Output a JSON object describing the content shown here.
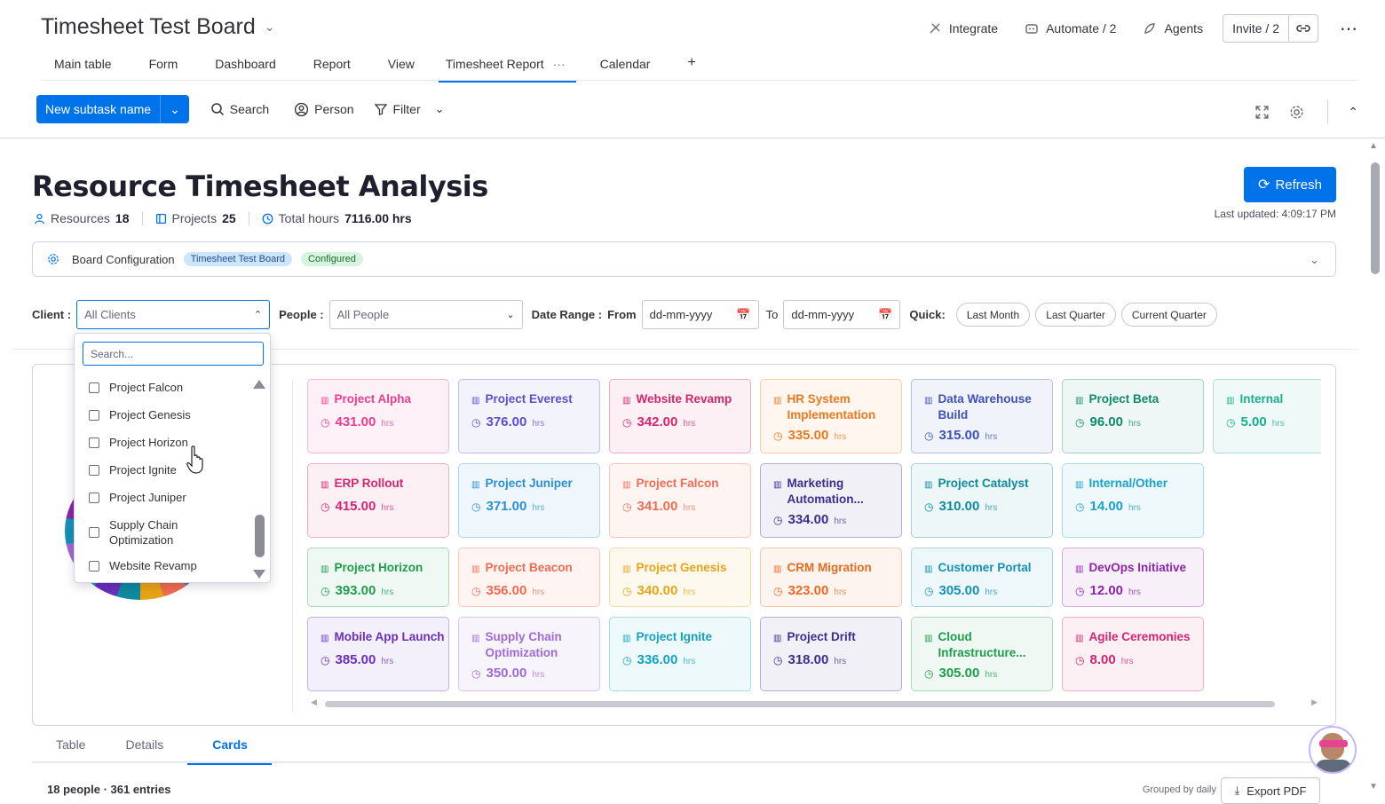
{
  "header": {
    "board_title": "Timesheet Test Board",
    "integrate": "Integrate",
    "automate": "Automate / 2",
    "agents": "Agents",
    "invite": "Invite / 2"
  },
  "tabs": [
    {
      "label": "Main table"
    },
    {
      "label": "Form"
    },
    {
      "label": "Dashboard"
    },
    {
      "label": "Report"
    },
    {
      "label": "View"
    },
    {
      "label": "Timesheet Report"
    },
    {
      "label": "Calendar"
    }
  ],
  "toolbar": {
    "new_button": "New subtask name",
    "search": "Search",
    "person": "Person",
    "filter": "Filter"
  },
  "report": {
    "title": "Resource Timesheet Analysis",
    "resources_label": "Resources",
    "resources_value": "18",
    "projects_label": "Projects",
    "projects_value": "25",
    "hours_label": "Total hours",
    "hours_value": "7116.00 hrs",
    "refresh": "Refresh",
    "last_updated": "Last updated: 4:09:17 PM"
  },
  "board_config": {
    "label": "Board Configuration",
    "board": "Timesheet Test Board",
    "status": "Configured"
  },
  "filters": {
    "client_label": "Client :",
    "client_value": "All Clients",
    "people_label": "People :",
    "people_value": "All People",
    "date_range_label": "Date Range :",
    "from_label": "From",
    "from_placeholder": "dd-mm-yyyy",
    "to_label": "To",
    "to_placeholder": "dd-mm-yyyy",
    "quick_label": "Quick:",
    "quick": [
      "Last Month",
      "Last Quarter",
      "Current Quarter"
    ]
  },
  "client_dropdown": {
    "search_placeholder": "Search...",
    "items": [
      "Project Falcon",
      "Project Genesis",
      "Project Horizon",
      "Project Ignite",
      "Project Juniper",
      "Supply Chain Optimization",
      "Website Revamp"
    ]
  },
  "cards": [
    {
      "name": "Project Alpha",
      "hours": "431.00",
      "unit": "hrs",
      "color": "#e83e8c"
    },
    {
      "name": "Project Everest",
      "hours": "376.00",
      "unit": "hrs",
      "color": "#5b4fcf"
    },
    {
      "name": "Website Revamp",
      "hours": "342.00",
      "unit": "hrs",
      "color": "#d6246e"
    },
    {
      "name": "HR System Implementation",
      "hours": "335.00",
      "unit": "hrs",
      "color": "#ea7a1f"
    },
    {
      "name": "Data Warehouse Build",
      "hours": "315.00",
      "unit": "hrs",
      "color": "#3f51b5"
    },
    {
      "name": "Project Beta",
      "hours": "96.00",
      "unit": "hrs",
      "color": "#0f8a6b"
    },
    {
      "name": "Internal",
      "hours": "5.00",
      "unit": "hrs",
      "color": "#17b08c"
    },
    {
      "name": "ERP Rollout",
      "hours": "415.00",
      "unit": "hrs",
      "color": "#d6246e"
    },
    {
      "name": "Project Juniper",
      "hours": "371.00",
      "unit": "hrs",
      "color": "#2a8fd6"
    },
    {
      "name": "Project Falcon",
      "hours": "341.00",
      "unit": "hrs",
      "color": "#ef6c52"
    },
    {
      "name": "Marketing Automation...",
      "hours": "334.00",
      "unit": "hrs",
      "color": "#3a2f8f"
    },
    {
      "name": "Project Catalyst",
      "hours": "310.00",
      "unit": "hrs",
      "color": "#0f8aa0"
    },
    {
      "name": "Internal/Other",
      "hours": "14.00",
      "unit": "hrs",
      "color": "#17a2c8"
    },
    {
      "name": "Project Horizon",
      "hours": "393.00",
      "unit": "hrs",
      "color": "#1d9e4a"
    },
    {
      "name": "Project Beacon",
      "hours": "356.00",
      "unit": "hrs",
      "color": "#ef6c52"
    },
    {
      "name": "Project Genesis",
      "hours": "340.00",
      "unit": "hrs",
      "color": "#e8a317"
    },
    {
      "name": "CRM Migration",
      "hours": "323.00",
      "unit": "hrs",
      "color": "#ea6a1f"
    },
    {
      "name": "Customer Portal",
      "hours": "305.00",
      "unit": "hrs",
      "color": "#1591b8"
    },
    {
      "name": "DevOps Initiative",
      "hours": "12.00",
      "unit": "hrs",
      "color": "#8e24aa"
    },
    {
      "name": "Mobile App Launch",
      "hours": "385.00",
      "unit": "hrs",
      "color": "#6a2fc0"
    },
    {
      "name": "Supply Chain Optimization",
      "hours": "350.00",
      "unit": "hrs",
      "color": "#a06ad6"
    },
    {
      "name": "Project Ignite",
      "hours": "336.00",
      "unit": "hrs",
      "color": "#13a3c0"
    },
    {
      "name": "Project Drift",
      "hours": "318.00",
      "unit": "hrs",
      "color": "#3a2f8f"
    },
    {
      "name": "Cloud Infrastructure...",
      "hours": "305.00",
      "unit": "hrs",
      "color": "#1d9e4a"
    },
    {
      "name": "Agile Ceremonies",
      "hours": "8.00",
      "unit": "hrs",
      "color": "#d6246e"
    }
  ],
  "bottom_tabs": [
    "Table",
    "Details",
    "Cards"
  ],
  "footer": {
    "summary": "18 people · 361 entries",
    "grouped": "Grouped by daily",
    "export": "Export PDF"
  }
}
